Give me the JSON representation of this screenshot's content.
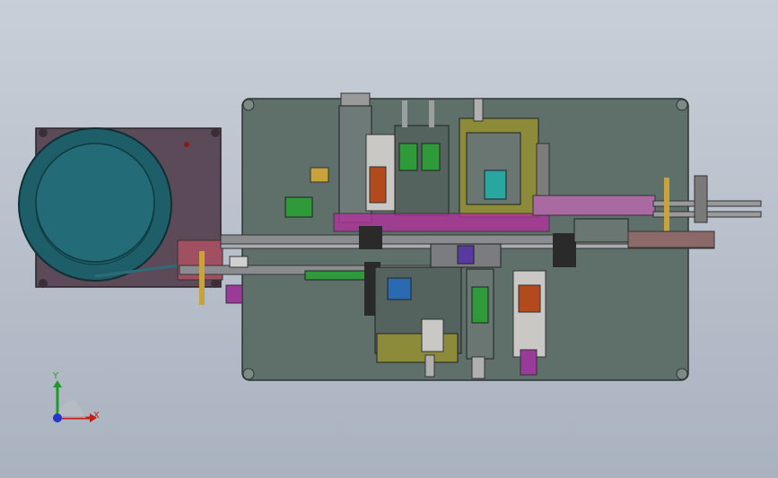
{
  "triad": {
    "x_label": "X",
    "y_label": "Y",
    "x_color": "#c0201a",
    "y_color": "#1f9a2a",
    "z_color": "#2a34c8"
  },
  "colors": {
    "background_top": "#c9cfd8",
    "background_bottom": "#a9b2bf",
    "base_plate": "#5f6f6a",
    "bowl_feeder": "#1e5e68",
    "bowl_housing": "#5c4a58",
    "track": "#8a8c90",
    "highlight_magenta": "#b0339a",
    "highlight_green": "#2f9a3a",
    "highlight_olive": "#8c8b3a"
  }
}
